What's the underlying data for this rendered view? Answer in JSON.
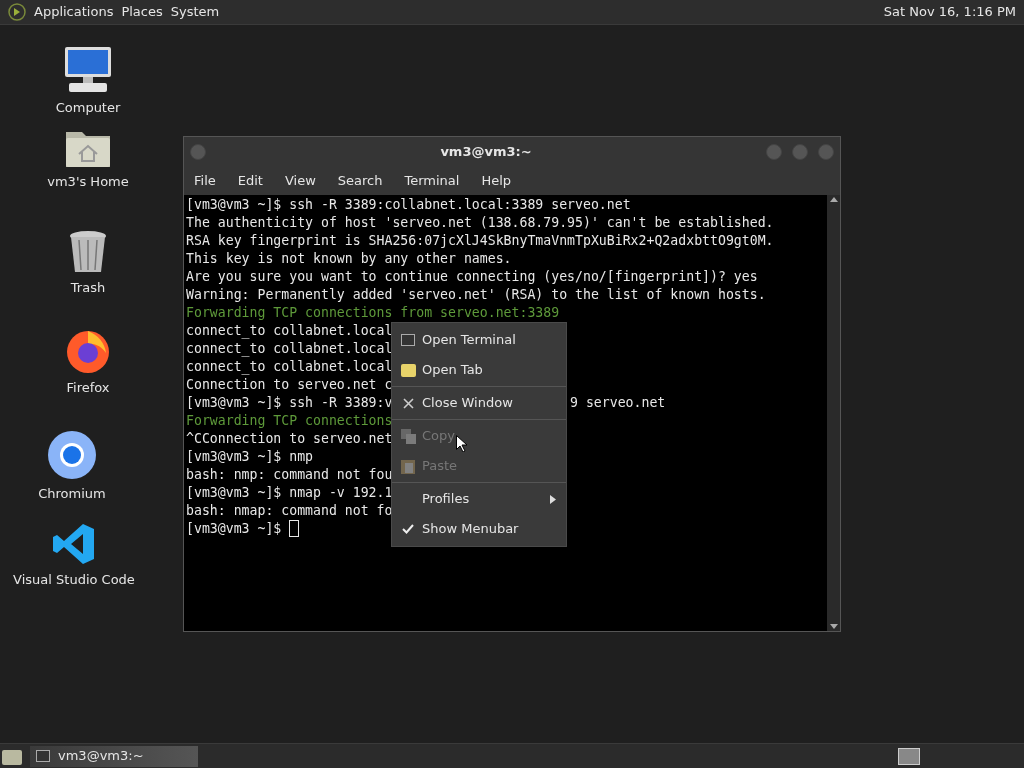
{
  "top_panel": {
    "menus": [
      "Applications",
      "Places",
      "System"
    ],
    "clock": "Sat Nov 16, 1:16 PM"
  },
  "desktop_icons": [
    {
      "kind": "computer",
      "label": "Computer"
    },
    {
      "kind": "home",
      "label": "vm3's Home"
    },
    {
      "kind": "trash",
      "label": "Trash"
    },
    {
      "kind": "firefox",
      "label": "Firefox"
    },
    {
      "kind": "chromium",
      "label": "Chromium"
    },
    {
      "kind": "vscode",
      "label": "Visual Studio Code"
    }
  ],
  "window": {
    "title": "vm3@vm3:~",
    "menubar": [
      "File",
      "Edit",
      "View",
      "Search",
      "Terminal",
      "Help"
    ],
    "lines": [
      {
        "kind": "normal",
        "text": "[vm3@vm3 ~]$ ssh -R 3389:collabnet.local:3389 serveo.net"
      },
      {
        "kind": "normal",
        "text": "The authenticity of host 'serveo.net (138.68.79.95)' can't be established."
      },
      {
        "kind": "normal",
        "text": "RSA key fingerprint is SHA256:07jcXlJ4SkBnyTmaVnmTpXuBiRx2+Q2adxbttO9gt0M."
      },
      {
        "kind": "normal",
        "text": "This key is not known by any other names."
      },
      {
        "kind": "normal",
        "text": "Are you sure you want to continue connecting (yes/no/[fingerprint])? yes"
      },
      {
        "kind": "normal",
        "text": "Warning: Permanently added 'serveo.net' (RSA) to the list of known hosts."
      },
      {
        "kind": "green",
        "text": "Forwarding TCP connections from serveo.net:3389"
      },
      {
        "kind": "normal",
        "text": "connect_to collabnet.local"
      },
      {
        "kind": "normal",
        "text": "connect_to collabnet.local"
      },
      {
        "kind": "normal",
        "text": "connect_to collabnet.local"
      },
      {
        "kind": "normal",
        "text": "Connection to serveo.net c"
      },
      {
        "kind": "normal",
        "text": "[vm3@vm3 ~]$ ssh -R 3389:v",
        "after_menu": "9 serveo.net"
      },
      {
        "kind": "green",
        "text": "Forwarding TCP connections"
      },
      {
        "kind": "normal",
        "text": "^CConnection to serveo.net"
      },
      {
        "kind": "normal",
        "text": "[vm3@vm3 ~]$ nmp"
      },
      {
        "kind": "normal",
        "text": "bash: nmp: command not fou"
      },
      {
        "kind": "normal",
        "text": "[vm3@vm3 ~]$ nmap -v 192.1"
      },
      {
        "kind": "normal",
        "text": "bash: nmap: command not fo"
      },
      {
        "kind": "prompt",
        "text": "[vm3@vm3 ~]$ "
      }
    ]
  },
  "context_menu": [
    {
      "kind": "terminal",
      "label": "Open Terminal",
      "disabled": false
    },
    {
      "kind": "tab",
      "label": "Open Tab",
      "disabled": false
    },
    {
      "kind": "separator"
    },
    {
      "kind": "close",
      "label": "Close Window",
      "disabled": false
    },
    {
      "kind": "separator"
    },
    {
      "kind": "copy",
      "label": "Copy",
      "disabled": true
    },
    {
      "kind": "paste",
      "label": "Paste",
      "disabled": true
    },
    {
      "kind": "separator"
    },
    {
      "kind": "submenu",
      "label": "Profiles",
      "disabled": false
    },
    {
      "kind": "toggle",
      "label": "Show Menubar",
      "disabled": false,
      "checked": true
    }
  ],
  "taskbar": {
    "windows": [
      {
        "title": "vm3@vm3:~",
        "selected": false
      }
    ]
  }
}
